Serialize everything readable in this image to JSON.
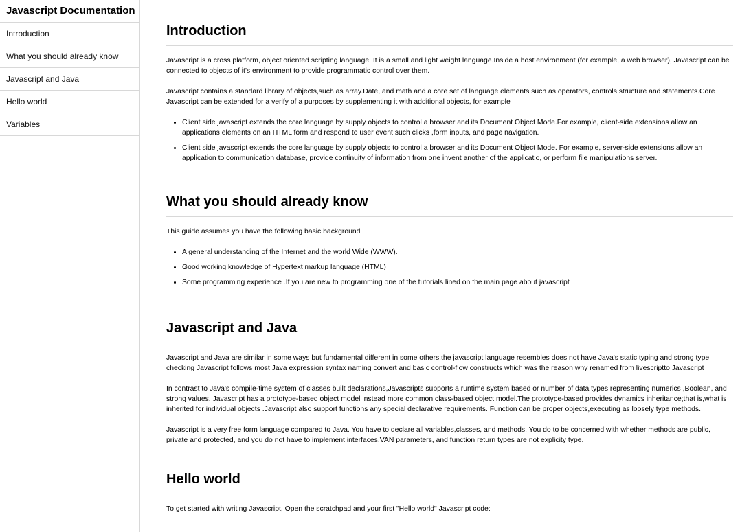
{
  "nav": {
    "title": "Javascript Documentation",
    "links": [
      "Introduction",
      "What you should already know",
      "Javascript and Java",
      "Hello world",
      "Variables"
    ]
  },
  "sections": {
    "introduction": {
      "heading": "Introduction",
      "p1": "Javascript is a cross platform, object oriented scripting language .It is a small and light weight language.Inside a host environment (for example, a web browser), Javascript can be connected to objects of it's environment to provide programmatic control over them.",
      "p2": "Javascript contains a standard library of objects,such as array.Date, and math and a core set of language elements such as operators, controls structure and statements.Core Javascript can be extended for a verify of a purposes by supplementing it with additional objects, for example",
      "items": [
        "Client side javascript extends the core language by supply objects to control a browser and its Document Object Mode.For example, client-side extensions allow an applications elements on an HTML form and respond to user event such clicks ,form inputs, and page navigation.",
        "Client side javascript extends the core language by supply objects to control a browser and its Document Object Mode. For example, server-side extensions allow an application to communication database, provide continuity of information from one invent another of the applicatio, or perform file manipulations server."
      ]
    },
    "know": {
      "heading": "What you should already know",
      "p1": "This guide assumes you have the following basic background",
      "items": [
        "A general understanding of the Internet and the world Wide (WWW).",
        "Good working knowledge of Hypertext markup language (HTML)",
        "Some programming experience .If you are new to programming one of the tutorials lined on the main page about javascript"
      ]
    },
    "java": {
      "heading": "Javascript and Java",
      "p1": "Javascript and Java are similar in some ways but fundamental different in some others.the javascript language resembles does not have Java's static typing and strong type checking Javascript follows most Java expression syntax naming convert and basic control-flow constructs which was the reason why renamed from livescriptto Javascript",
      "p2": "In contrast to Java's compile-time system of classes built declarations,Javascripts supports a runtime system based or number of data types representing numerics ,Boolean, and strong values. Javascript has a prototype-based object model instead more common class-based object model.The prototype-based provides dynamics inheritance;that is,what is inherited for individual objects .Javascript also support functions any special declarative requirements. Function can be proper objects,executing as loosely type methods.",
      "p3": "Javascript is a very free form language compared to Java. You have to declare all variables,classes, and methods. You do to be concerned with whether methods are public, private and protected, and you do not have to implement interfaces.VAN parameters, and function return types are not explicity type."
    },
    "hello": {
      "heading": "Hello world",
      "p1": "To get started with writing Javascript, Open the scratchpad and your first \"Hello world\" Javascript code:"
    }
  }
}
